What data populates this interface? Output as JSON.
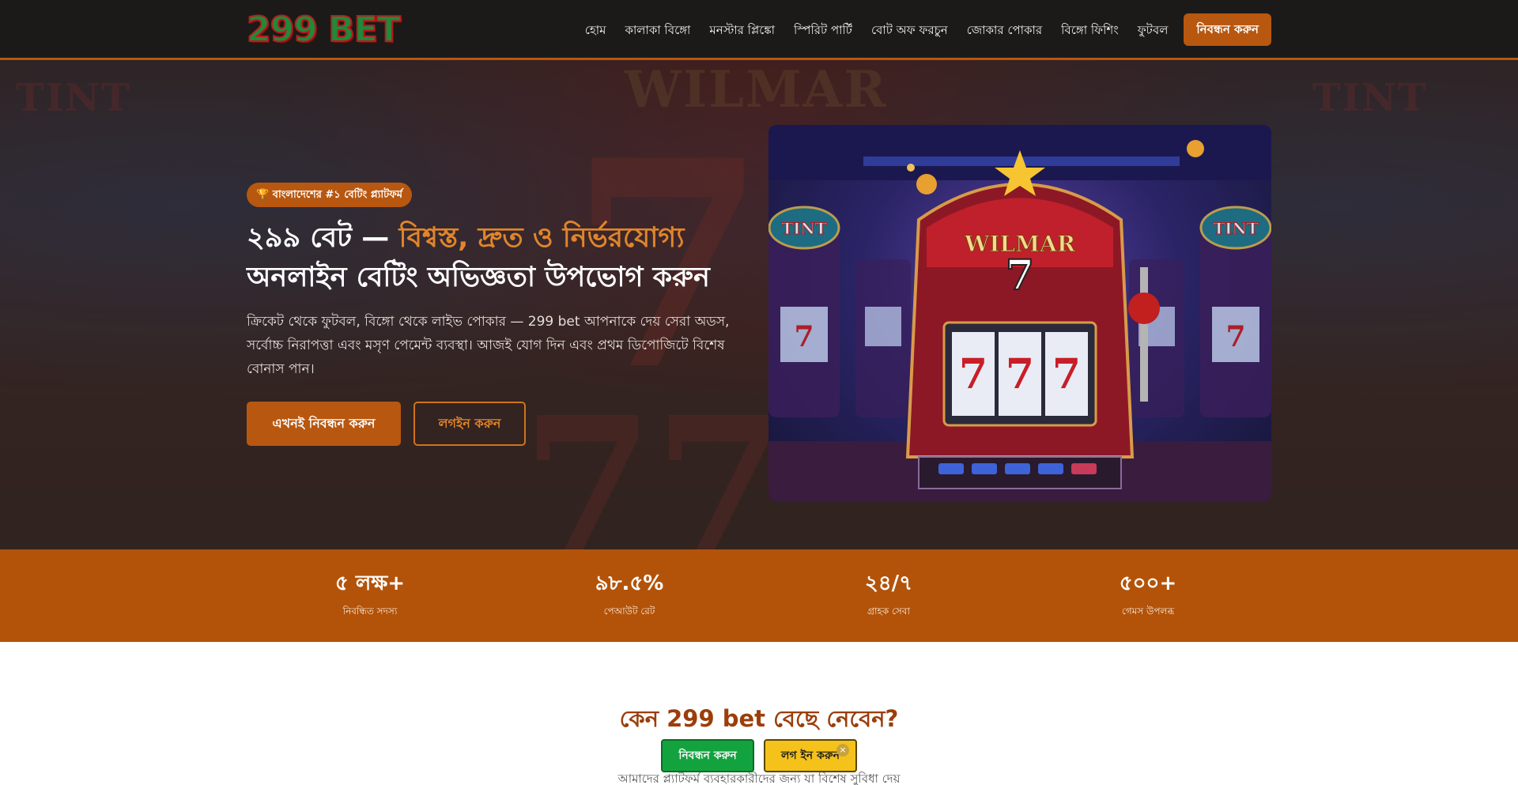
{
  "brand": {
    "logo_text": "299 BET"
  },
  "nav": {
    "links": [
      "হোম",
      "কালাকা বিঙ্গো",
      "মনস্টার প্লিঙ্কো",
      "স্পিরিট পার্টি",
      "বোট অফ ফরচুন",
      "জোকার পোকার",
      "বিঙ্গো ফিশিং",
      "ফুটবল"
    ],
    "cta": "নিবন্ধন করুন"
  },
  "hero": {
    "badge": "🏆 বাংলাদেশের #১ বেটিং প্ল্যাটফর্ম",
    "title_part1": "২৯৯ বেট — ",
    "title_accent": "বিশ্বস্ত, দ্রুত ও নির্ভরযোগ্য",
    "title_part2": "অনলাইন বেটিং অভিজ্ঞতা উপভোগ করুন",
    "description": "ক্রিকেট থেকে ফুটবল, বিঙ্গো থেকে লাইভ পোকার — 299 bet আপনাকে দেয় সেরা অডস, সর্বোচ্চ নিরাপত্তা এবং মসৃণ পেমেন্ট ব্যবস্থা। আজই যোগ দিন এবং প্রথম ডিপোজিটে বিশেষ বোনাস পান।",
    "primary_button": "এখনই নিবন্ধন করুন",
    "secondary_button": "লগইন করুন",
    "image_sign": "WILMAR",
    "image_side_sign": "TINT"
  },
  "stats": [
    {
      "value": "৫ লক্ষ+",
      "label": "নিবন্ধিত সদস্য"
    },
    {
      "value": "৯৮.৫%",
      "label": "পেআউট রেট"
    },
    {
      "value": "২৪/৭",
      "label": "গ্রাহক সেবা"
    },
    {
      "value": "৫০০+",
      "label": "গেমস উপলব্ধ"
    }
  ],
  "why": {
    "title": "কেন 299 bet বেছে নেবেন?",
    "subtitle": "আমাদের প্ল্যাটফর্ম ব্যবহারকারীদের জন্য যা বিশেষ সুবিধা দেয়"
  },
  "floating": {
    "register": "নিবন্ধন করুন",
    "login": "লগ ইন করুন",
    "close": "×"
  },
  "colors": {
    "accent": "#b8570f",
    "nav_bg": "#1b1a19",
    "stats_bg": "#b35309",
    "heading_accent": "#e0852b",
    "float_green": "#13a33e",
    "float_yellow": "#f4c21a"
  }
}
